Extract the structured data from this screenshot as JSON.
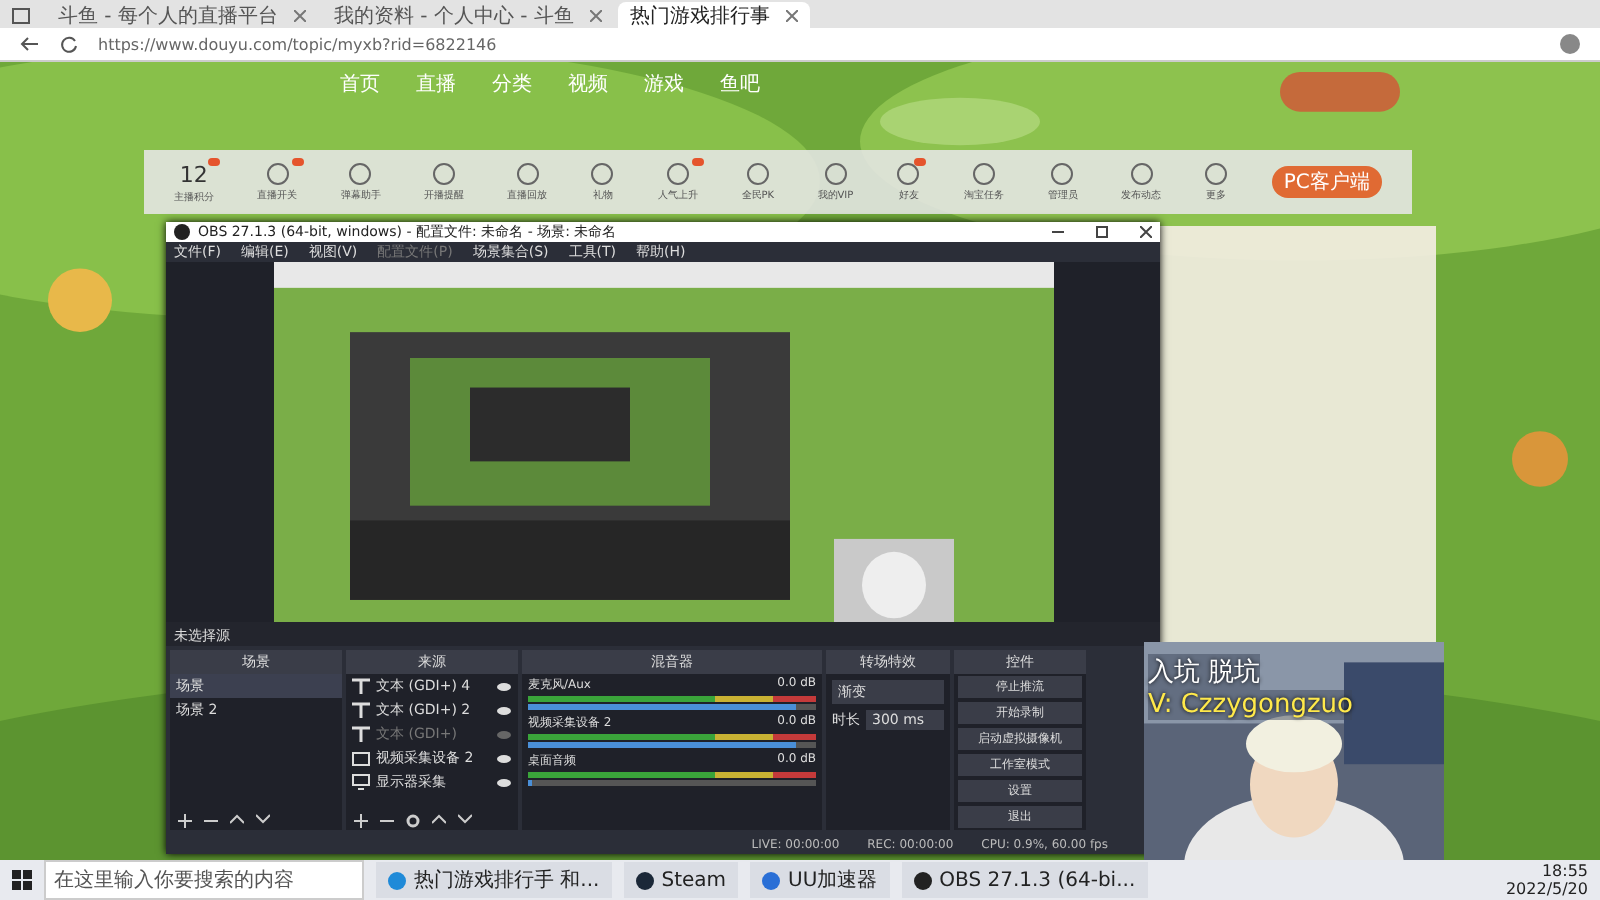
{
  "browser": {
    "tabs": [
      {
        "title": "斗鱼 - 每个人的直播平台",
        "selected": false
      },
      {
        "title": "我的资料 - 个人中心 - 斗鱼",
        "selected": false
      },
      {
        "title": "热门游戏排行事",
        "selected": true
      }
    ],
    "url": "https://www.douyu.com/topic/myxb?rid=6822146"
  },
  "site_nav": [
    "首页",
    "直播",
    "分类",
    "视频",
    "游戏",
    "鱼吧"
  ],
  "toolbar": {
    "score": "12",
    "items": [
      {
        "label": "主播积分",
        "badge": true
      },
      {
        "label": "直播开关",
        "badge": true
      },
      {
        "label": "弹幕助手",
        "badge": false
      },
      {
        "label": "开播提醒",
        "badge": false
      },
      {
        "label": "直播回放",
        "badge": false
      },
      {
        "label": "礼物",
        "badge": false
      },
      {
        "label": "人气上升",
        "badge": true
      },
      {
        "label": "全民PK",
        "badge": false
      },
      {
        "label": "我的VIP",
        "badge": false
      },
      {
        "label": "好友",
        "badge": true
      },
      {
        "label": "淘宝任务",
        "badge": false
      },
      {
        "label": "管理员",
        "badge": false
      },
      {
        "label": "发布动态",
        "badge": false
      },
      {
        "label": "更多",
        "badge": false
      }
    ],
    "client_button": "PC客户端"
  },
  "obs": {
    "title": "OBS 27.1.3 (64-bit, windows) - 配置文件: 未命名 - 场景: 未命名",
    "menu": [
      {
        "label": "文件(F)",
        "disabled": false
      },
      {
        "label": "编辑(E)",
        "disabled": false
      },
      {
        "label": "视图(V)",
        "disabled": false
      },
      {
        "label": "配置文件(P)",
        "disabled": true
      },
      {
        "label": "场景集合(S)",
        "disabled": false
      },
      {
        "label": "工具(T)",
        "disabled": false
      },
      {
        "label": "帮助(H)",
        "disabled": false
      }
    ],
    "no_source": "未选择源",
    "scenes": {
      "title": "场景",
      "items": [
        {
          "label": "场景",
          "selected": true
        },
        {
          "label": "场景 2",
          "selected": false
        }
      ]
    },
    "sources": {
      "title": "来源",
      "items": [
        {
          "label": "文本 (GDI+) 4",
          "kind": "text",
          "visible": true
        },
        {
          "label": "文本 (GDI+) 2",
          "kind": "text",
          "visible": true
        },
        {
          "label": "文本 (GDI+)",
          "kind": "text",
          "visible": false
        },
        {
          "label": "视频采集设备 2",
          "kind": "camera",
          "visible": true
        },
        {
          "label": "显示器采集",
          "kind": "display",
          "visible": true
        }
      ]
    },
    "mixer": {
      "title": "混音器",
      "channels": [
        {
          "name": "麦克风/Aux",
          "reading": "0.0 dB",
          "level": 0.93
        },
        {
          "name": "视频采集设备 2",
          "reading": "0.0 dB",
          "level": 0.93
        },
        {
          "name": "桌面音频",
          "reading": "0.0 dB",
          "level": 0.0
        }
      ]
    },
    "transitions": {
      "title": "转场特效",
      "value": "渐变",
      "duration_label": "时长",
      "duration": "300 ms"
    },
    "controls": {
      "title": "控件",
      "buttons": [
        "停止推流",
        "开始录制",
        "启动虚拟摄像机",
        "工作室模式",
        "设置",
        "退出"
      ]
    },
    "status": {
      "live": "LIVE: 00:00:00",
      "rec": "REC: 00:00:00",
      "cpu": "CPU: 0.9%, 60.00 fps"
    }
  },
  "webcam_overlay": [
    "入坑 脱坑",
    "V: Czzygongzuo"
  ],
  "taskbar": {
    "search": "在这里输入你要搜索的内容",
    "apps": [
      {
        "label": "热门游戏排行手 和...",
        "kind": "edge"
      },
      {
        "label": "Steam",
        "kind": "steam"
      },
      {
        "label": "UU加速器",
        "kind": "uu"
      },
      {
        "label": "OBS 27.1.3 (64-bi...",
        "kind": "obs"
      }
    ],
    "time": "18:55",
    "date": "2022/5/20"
  }
}
